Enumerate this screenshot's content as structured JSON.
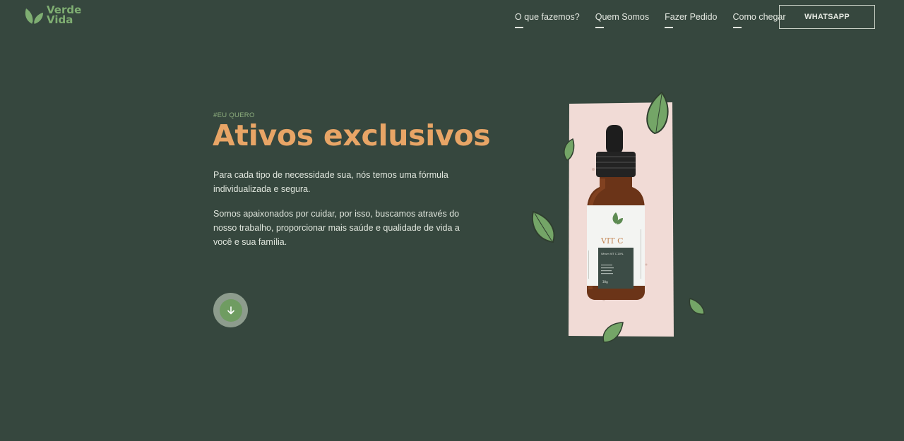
{
  "header": {
    "logo": {
      "line1": "Verde",
      "line2": "Vida",
      "icon": "leaf-logo-icon"
    },
    "nav": [
      {
        "label": "O que fazemos?"
      },
      {
        "label": "Quem Somos"
      },
      {
        "label": "Fazer Pedido"
      },
      {
        "label": "Como chegar"
      }
    ],
    "cta_label": "WHATSAPP"
  },
  "hero": {
    "eyebrow": "#EU QUERO",
    "title": "Ativos exclusivos",
    "paragraph1": "Para cada tipo de necessidade sua, nós temos uma fórmula individualizada e segura.",
    "paragraph2": "Somos apaixonados por cuidar, por isso, buscamos através do nosso trabalho, proporcionar mais saúde e qualidade de vida a você e sua família.",
    "scroll_icon": "arrow-down-icon"
  },
  "product": {
    "label_title": "VIT C",
    "label_subtitle": "Sérum VIT C 20%",
    "label_weight": "30g"
  },
  "colors": {
    "background": "#36473e",
    "accent_orange": "#e8a566",
    "accent_green": "#7fae72"
  }
}
